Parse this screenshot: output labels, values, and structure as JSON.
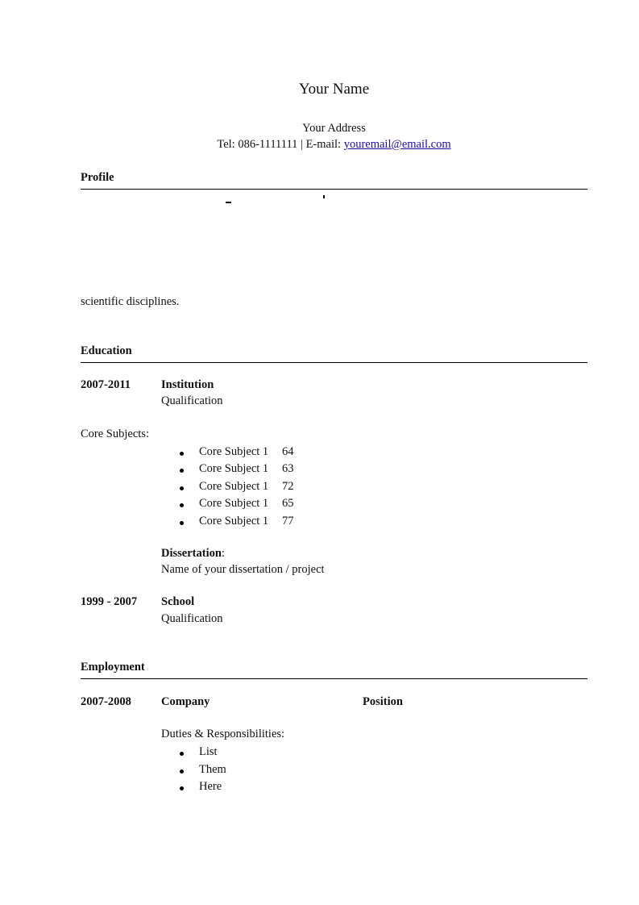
{
  "header": {
    "name": "Your Name",
    "address": "Your Address",
    "contact_prefix": "Tel: 086-1111111 | E-mail: ",
    "email": "youremail@email.com",
    "email_color": "#1a0dab"
  },
  "profile": {
    "heading": "Profile",
    "text_tail": "scientific disciplines."
  },
  "education": {
    "heading": "Education",
    "entries": [
      {
        "dates": "2007-2011",
        "institution": "Institution",
        "qualification": "Qualification",
        "core_subjects_label": "Core Subjects:",
        "subjects": [
          {
            "name": "Core Subject 1",
            "grade": "64"
          },
          {
            "name": "Core Subject 1",
            "grade": "63"
          },
          {
            "name": "Core Subject 1",
            "grade": "72"
          },
          {
            "name": "Core Subject 1",
            "grade": "65"
          },
          {
            "name": "Core Subject 1",
            "grade": "77"
          }
        ],
        "dissertation_label": "Dissertation",
        "dissertation_colon": ":",
        "dissertation_name": "Name of your dissertation / project"
      },
      {
        "dates": "1999 - 2007",
        "institution": "School",
        "qualification": "Qualification"
      }
    ]
  },
  "employment": {
    "heading": "Employment",
    "entries": [
      {
        "dates": "2007-2008",
        "company": "Company",
        "position": "Position",
        "duties_label": "Duties & Responsibilities:",
        "duties": [
          "List",
          "Them",
          "Here"
        ]
      }
    ]
  }
}
